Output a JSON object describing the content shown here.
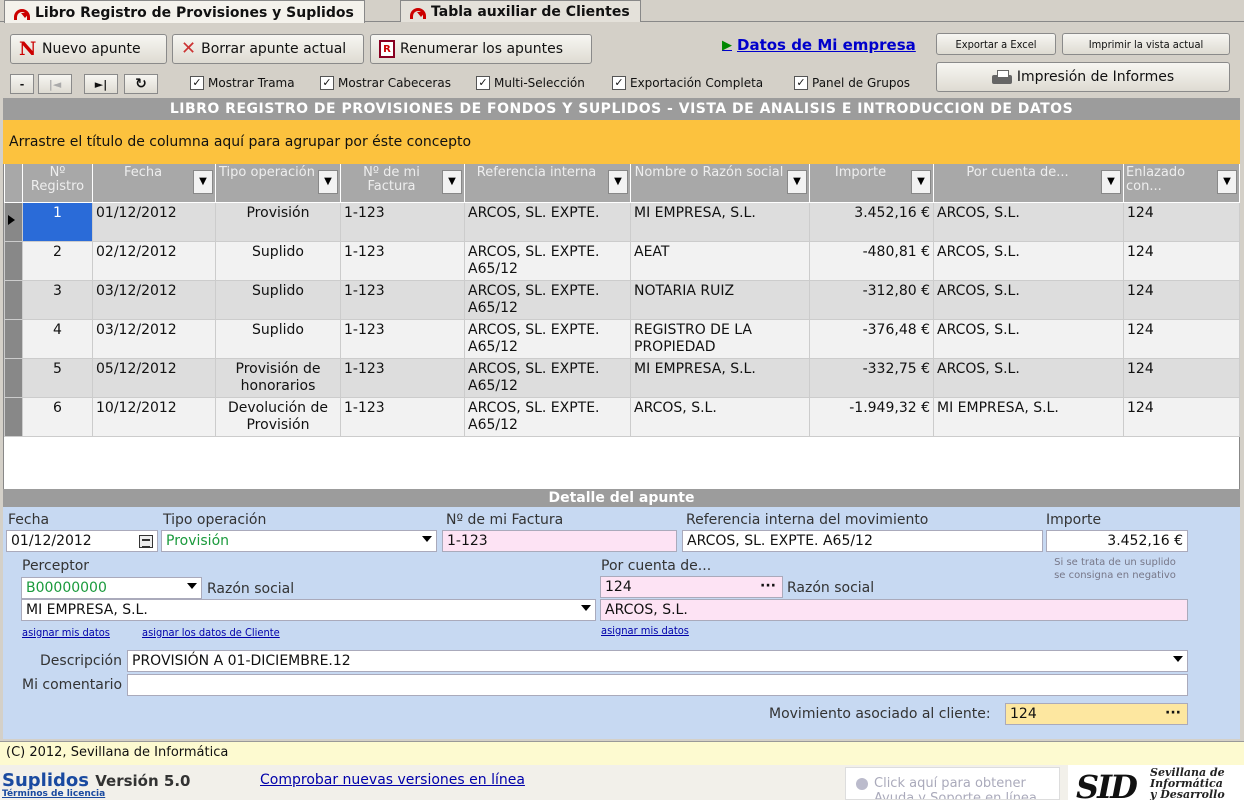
{
  "tabs": [
    {
      "label": "Libro Registro de Provisiones y Suplidos",
      "active": true
    },
    {
      "label": "Tabla auxiliar de Clientes",
      "active": false
    }
  ],
  "toolbar": {
    "new_label": "Nuevo apunte",
    "delete_label": "Borrar apunte actual",
    "renumber_label": "Renumerar los apuntes",
    "company_link": "Datos de Mi empresa",
    "export_label": "Exportar a Excel",
    "print_view_label": "Imprimir la vista actual",
    "reports_label": "Impresión de Informes",
    "nav": {
      "first": "-",
      "prev": "|◄",
      "next": "►|",
      "refresh": "↻"
    },
    "options": [
      {
        "label": "Mostrar Trama",
        "checked": true
      },
      {
        "label": "Mostrar Cabeceras",
        "checked": true
      },
      {
        "label": "Multi-Selección",
        "checked": true
      },
      {
        "label": "Exportación Completa",
        "checked": true
      },
      {
        "label": "Panel de Grupos",
        "checked": true
      }
    ]
  },
  "grid": {
    "title": "LIBRO REGISTRO DE PROVISIONES DE FONDOS Y SUPLIDOS - VISTA DE ANALISIS E INTRODUCCION DE DATOS",
    "group_hint": "Arrastre el título de columna aquí para agrupar por éste concepto",
    "columns": [
      "Nº Registro",
      "Fecha",
      "Tipo operación",
      "Nº de mi Factura",
      "Referencia interna",
      "Nombre o Razón social",
      "Importe",
      "Por cuenta de...",
      "Enlazado con..."
    ],
    "rows": [
      [
        "1",
        "01/12/2012",
        "Provisión",
        "1-123",
        "ARCOS, SL. EXPTE.",
        "MI EMPRESA, S.L.",
        "3.452,16 €",
        "ARCOS, S.L.",
        "124"
      ],
      [
        "2",
        "02/12/2012",
        "Suplido",
        "1-123",
        "ARCOS, SL. EXPTE. A65/12",
        "AEAT",
        "-480,81 €",
        "ARCOS, S.L.",
        "124"
      ],
      [
        "3",
        "03/12/2012",
        "Suplido",
        "1-123",
        "ARCOS, SL. EXPTE. A65/12",
        "NOTARIA RUIZ",
        "-312,80 €",
        "ARCOS, S.L.",
        "124"
      ],
      [
        "4",
        "03/12/2012",
        "Suplido",
        "1-123",
        "ARCOS, SL. EXPTE. A65/12",
        "REGISTRO DE LA PROPIEDAD",
        "-376,48 €",
        "ARCOS, S.L.",
        "124"
      ],
      [
        "5",
        "05/12/2012",
        "Provisión de honorarios",
        "1-123",
        "ARCOS, SL. EXPTE. A65/12",
        "MI EMPRESA, S.L.",
        "-332,75 €",
        "ARCOS, S.L.",
        "124"
      ],
      [
        "6",
        "10/12/2012",
        "Devolución de Provisión",
        "1-123",
        "ARCOS, SL. EXPTE. A65/12",
        "ARCOS, S.L.",
        "-1.949,32 €",
        "MI EMPRESA, S.L.",
        "124"
      ]
    ]
  },
  "detail": {
    "title": "Detalle del apunte",
    "fecha_label": "Fecha",
    "fecha_value": "01/12/2012",
    "tipo_label": "Tipo  operación",
    "tipo_value": "Provisión",
    "factura_label": "Nº de mi Factura",
    "factura_value": "1-123",
    "referencia_label": "Referencia interna del movimiento",
    "referencia_value": "ARCOS, SL. EXPTE. A65/12",
    "importe_label": "Importe",
    "importe_value": "3.452,16 €",
    "importe_note_1": "Si se trata de un suplido",
    "importe_note_2": "se consigna en negativo",
    "perceptor_label": "Perceptor",
    "perceptor_value": "B00000000",
    "razon_label_1": "Razón social",
    "perceptor_razon": "MI EMPRESA, S.L.",
    "por_cuenta_label": "Por cuenta de...",
    "por_cuenta_value": "124",
    "razon_label_2": "Razón social",
    "cuenta_razon": "ARCOS, S.L.",
    "asignar_mis_datos": "asignar mis datos",
    "asignar_cliente": "asignar los datos de Cliente",
    "asignar_mis_datos_2": "asignar mis datos",
    "descripcion_label": "Descripción",
    "descripcion_value": "PROVISIÓN A 01-DICIEMBRE.12",
    "comentario_label": "Mi comentario",
    "comentario_value": "",
    "movimiento_label": "Movimiento asociado al cliente:",
    "movimiento_value": "124"
  },
  "status": {
    "copyright": "(C) 2012, Sevillana de Informática"
  },
  "footer": {
    "product": "Suplidos",
    "version": "Versión 5.0",
    "license": "Términos de licencia",
    "check_versions": "Comprobar nuevas versiones en línea",
    "help_1": "Click aquí para obtener",
    "help_2": "Ayuda y Soporte en línea",
    "logo_mark": "SID",
    "logo_line1": "Sevillana de",
    "logo_line2": "Informática",
    "logo_line3": "y Desarrollo"
  }
}
